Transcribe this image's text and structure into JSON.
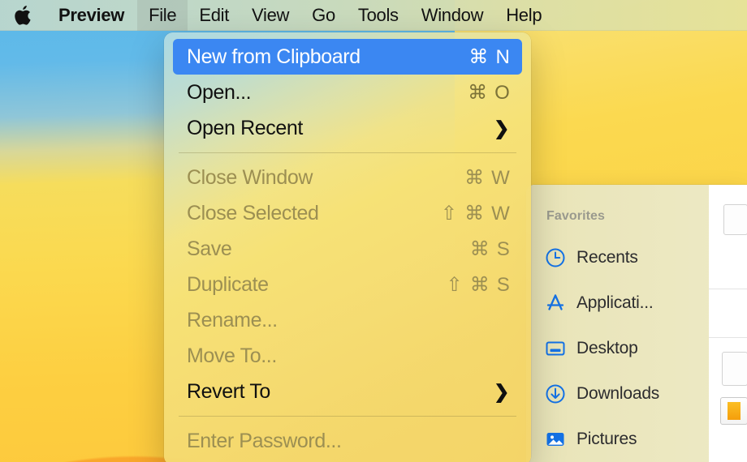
{
  "menubar": {
    "apple_icon": "apple-logo-icon",
    "app_name": "Preview",
    "items": [
      {
        "label": "File",
        "active": true
      },
      {
        "label": "Edit",
        "active": false
      },
      {
        "label": "View",
        "active": false
      },
      {
        "label": "Go",
        "active": false
      },
      {
        "label": "Tools",
        "active": false
      },
      {
        "label": "Window",
        "active": false
      },
      {
        "label": "Help",
        "active": false
      }
    ]
  },
  "file_menu": {
    "items": [
      {
        "label": "New from Clipboard",
        "shortcut": "⌘ N",
        "state": "selected",
        "submenu": false
      },
      {
        "label": "Open...",
        "shortcut": "⌘ O",
        "state": "enabled",
        "submenu": false
      },
      {
        "label": "Open Recent",
        "shortcut": "",
        "state": "enabled",
        "submenu": true
      },
      {
        "separator": true
      },
      {
        "label": "Close Window",
        "shortcut": "⌘ W",
        "state": "disabled",
        "submenu": false
      },
      {
        "label": "Close Selected",
        "shortcut": "⇧ ⌘ W",
        "state": "disabled",
        "submenu": false
      },
      {
        "label": "Save",
        "shortcut": "⌘ S",
        "state": "disabled",
        "submenu": false
      },
      {
        "label": "Duplicate",
        "shortcut": "⇧ ⌘ S",
        "state": "disabled",
        "submenu": false
      },
      {
        "label": "Rename...",
        "shortcut": "",
        "state": "disabled",
        "submenu": false
      },
      {
        "label": "Move To...",
        "shortcut": "",
        "state": "disabled",
        "submenu": false
      },
      {
        "label": "Revert To",
        "shortcut": "",
        "state": "enabled",
        "submenu": true
      },
      {
        "separator": true
      },
      {
        "label": "Enter Password...",
        "shortcut": "",
        "state": "disabled",
        "submenu": false
      }
    ],
    "submenu_chevron": "❯"
  },
  "finder": {
    "sidebar": {
      "header": "Favorites",
      "items": [
        {
          "label": "Recents",
          "icon": "clock-icon"
        },
        {
          "label": "Applicati...",
          "icon": "applications-icon"
        },
        {
          "label": "Desktop",
          "icon": "desktop-icon"
        },
        {
          "label": "Downloads",
          "icon": "download-icon"
        },
        {
          "label": "Pictures",
          "icon": "pictures-icon"
        }
      ]
    }
  },
  "colors": {
    "accent_blue": "#3b87f2",
    "sidebar_icon_blue": "#1472e6",
    "menu_disabled": "#9c8f52",
    "menubar_bg": "#bad6ce",
    "wallpaper_sky": "#5ab8e8",
    "wallpaper_sand": "#fbd94f",
    "wallpaper_sun": "#f9a72b"
  }
}
